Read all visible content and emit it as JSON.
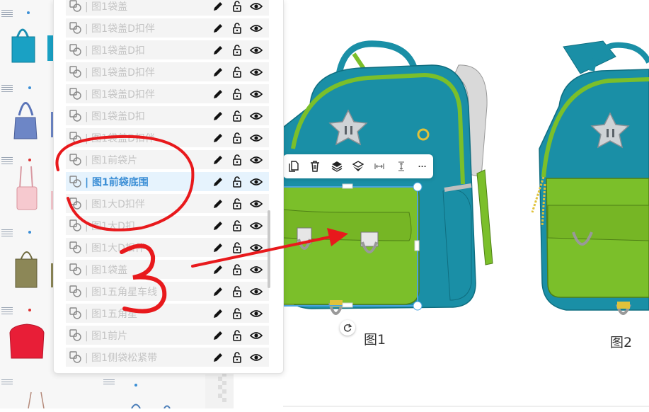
{
  "layers_panel": {
    "rows": [
      {
        "name": "| 图1袋盖",
        "active": false
      },
      {
        "name": "| 图1袋盖D扣伴",
        "active": false
      },
      {
        "name": "| 图1袋盖D扣",
        "active": false
      },
      {
        "name": "| 图1袋盖D扣伴",
        "active": false
      },
      {
        "name": "| 图1袋盖D扣伴",
        "active": false
      },
      {
        "name": "| 图1袋盖D扣",
        "active": false
      },
      {
        "name": "| 图1袋盖D扣伴",
        "active": false
      },
      {
        "name": "| 图1前袋片",
        "active": false
      },
      {
        "name": "| 图1前袋底围",
        "active": true
      },
      {
        "name": "| 图1大D扣伴",
        "active": false
      },
      {
        "name": "| 图1大D扣",
        "active": false
      },
      {
        "name": "| 图1大D扣伴",
        "active": false
      },
      {
        "name": "| 图1袋盖",
        "active": false
      },
      {
        "name": "| 图1五角星车线",
        "active": false
      },
      {
        "name": "| 图1五角星",
        "active": false
      },
      {
        "name": "| 图1前片",
        "active": false
      },
      {
        "name": "| 图1侧袋松紧带",
        "active": false
      }
    ],
    "icons": {
      "link": "link-layer-icon",
      "edit": "pencil-icon",
      "lock": "unlock-icon",
      "visible": "eye-icon"
    }
  },
  "toolbar": {
    "items": [
      "copy-icon",
      "delete-icon",
      "bring-forward-icon",
      "send-backward-icon",
      "flip-horizontal-icon",
      "flip-vertical-icon",
      "more-icon"
    ],
    "more_label": "···"
  },
  "canvas": {
    "figure1_label": "图1",
    "figure2_label": "图2"
  },
  "annotation": {
    "number": "3",
    "colors": {
      "ink": "#e8191c"
    }
  },
  "colors": {
    "teal": "#1a8fa6",
    "green": "#7bbf2a",
    "selection": "#4aa3df",
    "active_text": "#3c8fd6"
  }
}
